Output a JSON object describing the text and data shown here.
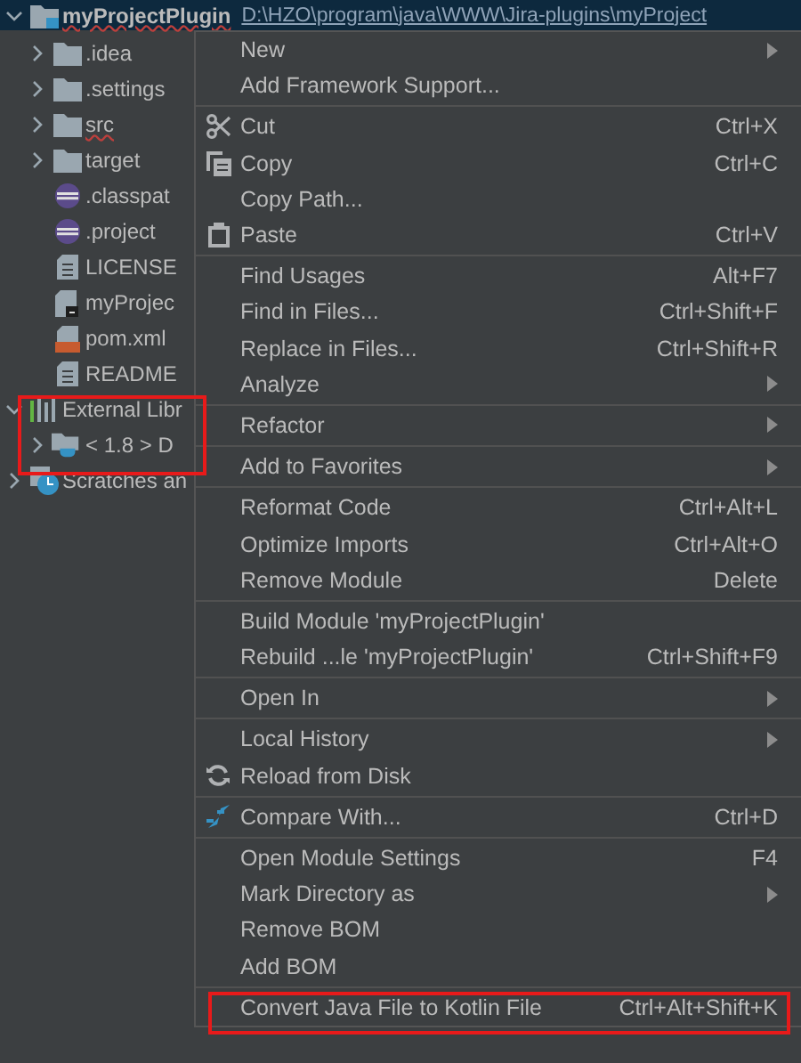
{
  "project_tree": [
    {
      "label": "myProjectPlugin",
      "path": "D:\\HZO\\program\\java\\WWW\\Jira-plugins\\myProject",
      "kind": "module",
      "expanded": true,
      "selected": true,
      "error": true,
      "children": [
        {
          "label": ".idea",
          "kind": "folder",
          "expanded": false,
          "selected": false,
          "error": false
        },
        {
          "label": ".settings",
          "kind": "folder",
          "expanded": false,
          "selected": false,
          "error": false
        },
        {
          "label": "src",
          "kind": "folder",
          "expanded": false,
          "selected": false,
          "error": true
        },
        {
          "label": "target",
          "kind": "folder",
          "expanded": false,
          "selected": false,
          "error": false
        },
        {
          "label": ".classpat",
          "kind": "eclipse",
          "selected": false,
          "error": false
        },
        {
          "label": ".project",
          "kind": "eclipse",
          "selected": false,
          "error": false
        },
        {
          "label": "LICENSE",
          "kind": "text",
          "selected": false,
          "error": false
        },
        {
          "label": "myProjec",
          "kind": "module-file",
          "selected": false,
          "error": false
        },
        {
          "label": "pom.xml",
          "kind": "xml",
          "selected": false,
          "error": false
        },
        {
          "label": "README",
          "kind": "text",
          "selected": false,
          "error": false
        }
      ]
    },
    {
      "label": "External Libr",
      "kind": "library",
      "expanded": true,
      "selected": false,
      "error": false,
      "children": [
        {
          "label": "< 1.8 >  D",
          "kind": "jdk",
          "expanded": false,
          "selected": false,
          "error": false
        }
      ]
    },
    {
      "label": "Scratches an",
      "kind": "scratches",
      "expanded": false,
      "selected": false,
      "error": false
    }
  ],
  "context_menu": [
    {
      "kind": "item",
      "label": "New",
      "submenu": true
    },
    {
      "kind": "item",
      "label": "Add Framework Support..."
    },
    {
      "kind": "separator"
    },
    {
      "kind": "cut",
      "label": "Cut",
      "shortcut": "Ctrl+X"
    },
    {
      "kind": "copy",
      "label": "Copy",
      "shortcut": "Ctrl+C"
    },
    {
      "kind": "item",
      "label": "Copy Path..."
    },
    {
      "kind": "paste",
      "label": "Paste",
      "shortcut": "Ctrl+V"
    },
    {
      "kind": "separator"
    },
    {
      "kind": "item",
      "label": "Find Usages",
      "shortcut": "Alt+F7"
    },
    {
      "kind": "item",
      "label": "Find in Files...",
      "shortcut": "Ctrl+Shift+F"
    },
    {
      "kind": "item",
      "label": "Replace in Files...",
      "shortcut": "Ctrl+Shift+R"
    },
    {
      "kind": "item",
      "label": "Analyze",
      "submenu": true
    },
    {
      "kind": "separator"
    },
    {
      "kind": "item",
      "label": "Refactor",
      "submenu": true
    },
    {
      "kind": "separator"
    },
    {
      "kind": "item",
      "label": "Add to Favorites",
      "submenu": true
    },
    {
      "kind": "separator"
    },
    {
      "kind": "item",
      "label": "Reformat Code",
      "shortcut": "Ctrl+Alt+L"
    },
    {
      "kind": "item",
      "label": "Optimize Imports",
      "shortcut": "Ctrl+Alt+O"
    },
    {
      "kind": "item",
      "label": "Remove Module",
      "shortcut": "Delete"
    },
    {
      "kind": "separator"
    },
    {
      "kind": "item",
      "label": "Build Module 'myProjectPlugin'"
    },
    {
      "kind": "item",
      "label": "Rebuild ...le 'myProjectPlugin'",
      "shortcut": "Ctrl+Shift+F9"
    },
    {
      "kind": "separator"
    },
    {
      "kind": "item",
      "label": "Open In",
      "submenu": true
    },
    {
      "kind": "separator"
    },
    {
      "kind": "item",
      "label": "Local History",
      "submenu": true
    },
    {
      "kind": "reload",
      "label": "Reload from Disk"
    },
    {
      "kind": "separator"
    },
    {
      "kind": "compare",
      "label": "Compare With...",
      "shortcut": "Ctrl+D"
    },
    {
      "kind": "separator"
    },
    {
      "kind": "item",
      "label": "Open Module Settings",
      "shortcut": "F4"
    },
    {
      "kind": "item",
      "label": "Mark Directory as",
      "submenu": true
    },
    {
      "kind": "item",
      "label": "Remove BOM"
    },
    {
      "kind": "item",
      "label": "Add BOM"
    },
    {
      "kind": "separator"
    },
    {
      "kind": "item",
      "label": "Convert Java File to Kotlin File",
      "shortcut": "Ctrl+Alt+Shift+K"
    }
  ]
}
